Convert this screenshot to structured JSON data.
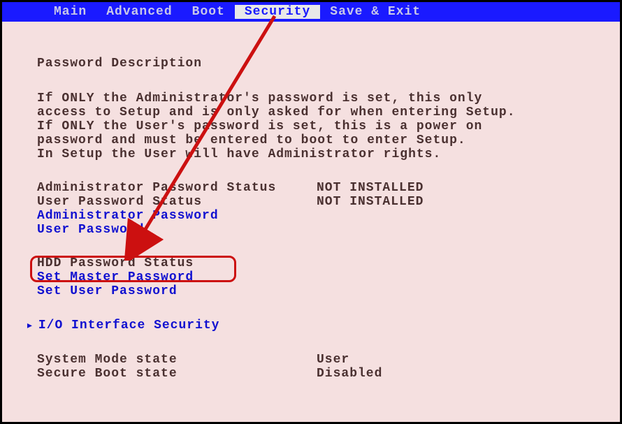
{
  "menu": {
    "items": [
      "Main",
      "Advanced",
      "Boot",
      "Security",
      "Save & Exit"
    ],
    "active_index": 3
  },
  "heading": "Password Description",
  "description": [
    "If ONLY the Administrator's password is set, this only",
    "access to Setup and is only asked for when entering Setup.",
    "If ONLY the User's password is set, this is a power on",
    "password and must be entered to boot to enter Setup.",
    "In Setup the User will have Administrator rights."
  ],
  "statuses": [
    {
      "label": "Administrator Password Status",
      "value": "NOT INSTALLED"
    },
    {
      "label": "User Password Status",
      "value": "NOT INSTALLED"
    }
  ],
  "password_links": [
    "Administrator Password",
    "User Password"
  ],
  "hdd": {
    "status_label": "HDD Password Status",
    "items": [
      "Set Master Password",
      "Set User Password"
    ]
  },
  "io_interface": "I/O Interface Security",
  "bottom_states": [
    {
      "label": "System Mode state",
      "value": "User"
    },
    {
      "label": "Secure Boot state",
      "value": "Disabled"
    }
  ]
}
